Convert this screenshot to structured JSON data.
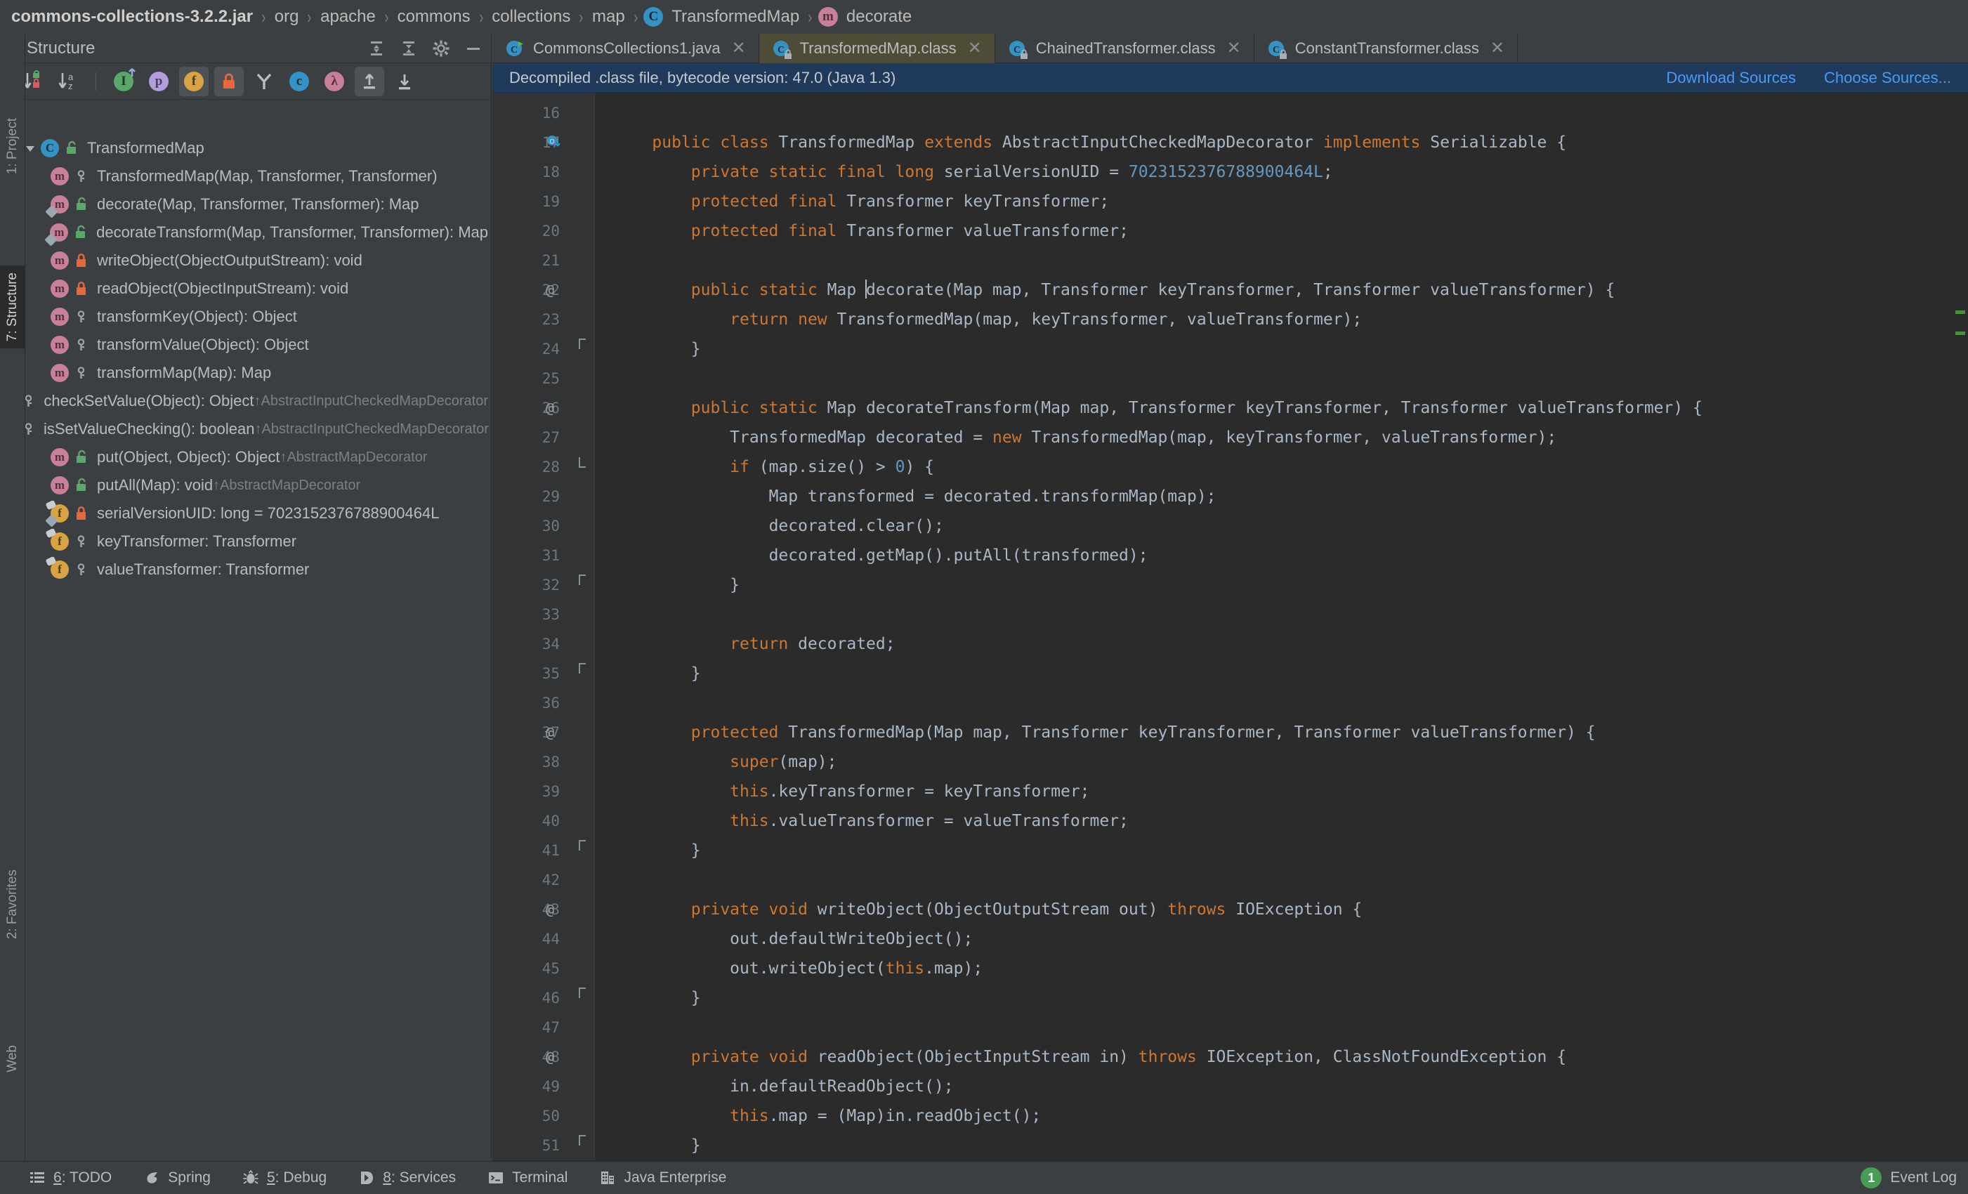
{
  "breadcrumb": {
    "items": [
      {
        "label": "commons-collections-3.2.2.jar",
        "icon": "",
        "bold": true
      },
      {
        "label": "org",
        "icon": "",
        "bold": false
      },
      {
        "label": "apache",
        "icon": "",
        "bold": false
      },
      {
        "label": "commons",
        "icon": "",
        "bold": false
      },
      {
        "label": "collections",
        "icon": "",
        "bold": false
      },
      {
        "label": "map",
        "icon": "",
        "bold": false
      },
      {
        "label": "TransformedMap",
        "icon": "class-icon",
        "bold": false
      },
      {
        "label": "decorate",
        "icon": "method-icon",
        "bold": false
      }
    ],
    "separator": "›"
  },
  "structure": {
    "title": "Structure",
    "header_buttons": [
      {
        "name": "expand-all-button",
        "icon": "expand-all-icon"
      },
      {
        "name": "collapse-all-button",
        "icon": "collapse-all-icon"
      },
      {
        "name": "settings-button",
        "icon": "gear-icon"
      },
      {
        "name": "hide-button",
        "icon": "minimize-icon"
      }
    ],
    "toolbar": [
      {
        "name": "sort-by-visibility-button",
        "icon": "sort-visibility-icon",
        "active": false
      },
      {
        "name": "sort-alphabetically-button",
        "icon": "sort-alpha-icon",
        "active": false
      },
      {
        "name": "show-inherited-button",
        "icon": "inherited-icon",
        "active": false,
        "glyph": "I"
      },
      {
        "name": "show-properties-button",
        "icon": "properties-icon",
        "active": false,
        "glyph": "p"
      },
      {
        "name": "show-fields-button",
        "icon": "fields-icon",
        "active": true,
        "glyph": "f"
      },
      {
        "name": "show-non-public-button",
        "icon": "lock-icon",
        "active": true,
        "glyph": ""
      },
      {
        "name": "group-methods-button",
        "icon": "group-methods-icon",
        "active": false
      },
      {
        "name": "show-anonymous-button",
        "icon": "anonymous-classes-icon",
        "active": false
      },
      {
        "name": "show-lambdas-button",
        "icon": "lambda-icon",
        "active": false
      },
      {
        "name": "autoscroll-to-source-button",
        "icon": "autoscroll-to-source-icon",
        "active": true
      },
      {
        "name": "autoscroll-from-source-button",
        "icon": "autoscroll-from-source-icon",
        "active": false
      }
    ],
    "tree": [
      {
        "label": "TransformedMap",
        "kind": "class",
        "modifier": "public",
        "indent": 0,
        "expanded": true,
        "override": false,
        "inherited": ""
      },
      {
        "label": "TransformedMap(Map, Transformer, Transformer)",
        "kind": "method",
        "modifier": "protected",
        "indent": 1,
        "override": false,
        "inherited": ""
      },
      {
        "label": "decorate(Map, Transformer, Transformer): Map",
        "kind": "method",
        "modifier": "public",
        "indent": 1,
        "override": true,
        "inherited": ""
      },
      {
        "label": "decorateTransform(Map, Transformer, Transformer): Map",
        "kind": "method",
        "modifier": "public",
        "indent": 1,
        "override": true,
        "inherited": ""
      },
      {
        "label": "writeObject(ObjectOutputStream): void",
        "kind": "method",
        "modifier": "private",
        "indent": 1,
        "override": false,
        "inherited": ""
      },
      {
        "label": "readObject(ObjectInputStream): void",
        "kind": "method",
        "modifier": "private",
        "indent": 1,
        "override": false,
        "inherited": ""
      },
      {
        "label": "transformKey(Object): Object",
        "kind": "method",
        "modifier": "protected",
        "indent": 1,
        "override": false,
        "inherited": ""
      },
      {
        "label": "transformValue(Object): Object",
        "kind": "method",
        "modifier": "protected",
        "indent": 1,
        "override": false,
        "inherited": ""
      },
      {
        "label": "transformMap(Map): Map",
        "kind": "method",
        "modifier": "protected",
        "indent": 1,
        "override": false,
        "inherited": ""
      },
      {
        "label": "checkSetValue(Object): Object",
        "kind": "method",
        "modifier": "protected",
        "indent": 1,
        "override": false,
        "inherited": "↑AbstractInputCheckedMapDecorator"
      },
      {
        "label": "isSetValueChecking(): boolean",
        "kind": "method",
        "modifier": "protected",
        "indent": 1,
        "override": false,
        "inherited": "↑AbstractInputCheckedMapDecorator"
      },
      {
        "label": "put(Object, Object): Object",
        "kind": "method",
        "modifier": "public",
        "indent": 1,
        "override": false,
        "inherited": "↑AbstractMapDecorator"
      },
      {
        "label": "putAll(Map): void",
        "kind": "method",
        "modifier": "public",
        "indent": 1,
        "override": false,
        "inherited": "↑AbstractMapDecorator"
      },
      {
        "label": "serialVersionUID: long = 7023152376788900464L",
        "kind": "field",
        "modifier": "private",
        "indent": 1,
        "override": true,
        "inherited": ""
      },
      {
        "label": "keyTransformer: Transformer",
        "kind": "field",
        "modifier": "protected",
        "indent": 1,
        "override": false,
        "inherited": ""
      },
      {
        "label": "valueTransformer: Transformer",
        "kind": "field",
        "modifier": "protected",
        "indent": 1,
        "override": false,
        "inherited": ""
      }
    ]
  },
  "left_rail": [
    {
      "label": "1: Project",
      "name": "rail-project",
      "selected": false
    },
    {
      "label": "7: Structure",
      "name": "rail-structure",
      "selected": true
    },
    {
      "label": "2: Favorites",
      "name": "rail-favorites",
      "selected": false
    },
    {
      "label": "Web",
      "name": "rail-web",
      "selected": false
    }
  ],
  "editor": {
    "tabs": [
      {
        "label": "CommonsCollections1.java",
        "icon": "java-class-icon",
        "active": false,
        "locked": false
      },
      {
        "label": "TransformedMap.class",
        "icon": "java-class-icon",
        "active": true,
        "locked": true
      },
      {
        "label": "ChainedTransformer.class",
        "icon": "java-class-icon",
        "active": false,
        "locked": true
      },
      {
        "label": "ConstantTransformer.class",
        "icon": "java-class-icon",
        "active": false,
        "locked": true
      }
    ],
    "notification": {
      "text": "Decompiled .class file, bytecode version: 47.0 (Java 1.3)",
      "links": [
        "Download Sources",
        "Choose Sources..."
      ],
      "background": "#1f3a5a",
      "link_color": "#4a9bf5"
    },
    "first_line_number": 16,
    "lines": [
      {
        "n": 16,
        "tokens": [],
        "gmark": "",
        "fold": ""
      },
      {
        "n": 17,
        "gmark": "impl",
        "fold": "",
        "tokens": [
          {
            "t": "    ",
            "c": ""
          },
          {
            "t": "public ",
            "c": "kw"
          },
          {
            "t": "class ",
            "c": "kw"
          },
          {
            "t": "TransformedMap ",
            "c": "cls"
          },
          {
            "t": "extends ",
            "c": "kw"
          },
          {
            "t": "AbstractInputCheckedMapDecorator ",
            "c": "cls"
          },
          {
            "t": "implements ",
            "c": "kw"
          },
          {
            "t": "Serializable {",
            "c": "cls"
          }
        ]
      },
      {
        "n": 18,
        "gmark": "",
        "fold": "",
        "tokens": [
          {
            "t": "        ",
            "c": ""
          },
          {
            "t": "private static final long ",
            "c": "kw"
          },
          {
            "t": "serialVersionUID = ",
            "c": "cls"
          },
          {
            "t": "7023152376788900464L",
            "c": "num"
          },
          {
            "t": ";",
            "c": "cls"
          }
        ]
      },
      {
        "n": 19,
        "gmark": "",
        "fold": "",
        "tokens": [
          {
            "t": "        ",
            "c": ""
          },
          {
            "t": "protected final ",
            "c": "kw"
          },
          {
            "t": "Transformer keyTransformer;",
            "c": "cls"
          }
        ]
      },
      {
        "n": 20,
        "gmark": "",
        "fold": "",
        "tokens": [
          {
            "t": "        ",
            "c": ""
          },
          {
            "t": "protected final ",
            "c": "kw"
          },
          {
            "t": "Transformer valueTransformer;",
            "c": "cls"
          }
        ]
      },
      {
        "n": 21,
        "gmark": "",
        "fold": "",
        "tokens": []
      },
      {
        "n": 22,
        "gmark": "@",
        "fold": "",
        "tokens": [
          {
            "t": "        ",
            "c": ""
          },
          {
            "t": "public static ",
            "c": "kw"
          },
          {
            "t": "Map ",
            "c": "cls"
          },
          {
            "t": "|CURSOR|",
            "c": "cursor"
          },
          {
            "t": "decorate(Map map, Transformer keyTransformer, Transformer valueTransformer) {",
            "c": "cls"
          }
        ]
      },
      {
        "n": 23,
        "gmark": "",
        "fold": "",
        "tokens": [
          {
            "t": "            ",
            "c": ""
          },
          {
            "t": "return new ",
            "c": "kw"
          },
          {
            "t": "TransformedMap(map, keyTransformer, valueTransformer);",
            "c": "cls"
          }
        ]
      },
      {
        "n": 24,
        "gmark": "",
        "fold": "up",
        "tokens": [
          {
            "t": "        }",
            "c": "cls"
          }
        ]
      },
      {
        "n": 25,
        "gmark": "",
        "fold": "",
        "tokens": []
      },
      {
        "n": 26,
        "gmark": "@",
        "fold": "",
        "tokens": [
          {
            "t": "        ",
            "c": ""
          },
          {
            "t": "public static ",
            "c": "kw"
          },
          {
            "t": "Map decorateTransform(Map map, Transformer keyTransformer, Transformer valueTransformer) {",
            "c": "cls"
          }
        ]
      },
      {
        "n": 27,
        "gmark": "",
        "fold": "",
        "tokens": [
          {
            "t": "            ",
            "c": ""
          },
          {
            "t": "TransformedMap decorated = ",
            "c": "cls"
          },
          {
            "t": "new ",
            "c": "kw"
          },
          {
            "t": "TransformedMap(map, keyTransformer, valueTransformer);",
            "c": "cls"
          }
        ]
      },
      {
        "n": 28,
        "gmark": "",
        "fold": "down",
        "tokens": [
          {
            "t": "            ",
            "c": ""
          },
          {
            "t": "if ",
            "c": "kw"
          },
          {
            "t": "(map.size() > ",
            "c": "cls"
          },
          {
            "t": "0",
            "c": "num"
          },
          {
            "t": ") {",
            "c": "cls"
          }
        ]
      },
      {
        "n": 29,
        "gmark": "",
        "fold": "",
        "tokens": [
          {
            "t": "                ",
            "c": ""
          },
          {
            "t": "Map transformed = decorated.transformMap(map);",
            "c": "cls"
          }
        ]
      },
      {
        "n": 30,
        "gmark": "",
        "fold": "",
        "tokens": [
          {
            "t": "                ",
            "c": ""
          },
          {
            "t": "decorated.clear();",
            "c": "cls"
          }
        ]
      },
      {
        "n": 31,
        "gmark": "",
        "fold": "",
        "tokens": [
          {
            "t": "                ",
            "c": ""
          },
          {
            "t": "decorated.getMap().putAll(transformed);",
            "c": "cls"
          }
        ]
      },
      {
        "n": 32,
        "gmark": "",
        "fold": "up",
        "tokens": [
          {
            "t": "            }",
            "c": "cls"
          }
        ]
      },
      {
        "n": 33,
        "gmark": "",
        "fold": "",
        "tokens": []
      },
      {
        "n": 34,
        "gmark": "",
        "fold": "",
        "tokens": [
          {
            "t": "            ",
            "c": ""
          },
          {
            "t": "return ",
            "c": "kw"
          },
          {
            "t": "decorated;",
            "c": "cls"
          }
        ]
      },
      {
        "n": 35,
        "gmark": "",
        "fold": "up",
        "tokens": [
          {
            "t": "        }",
            "c": "cls"
          }
        ]
      },
      {
        "n": 36,
        "gmark": "",
        "fold": "",
        "tokens": []
      },
      {
        "n": 37,
        "gmark": "@",
        "fold": "",
        "tokens": [
          {
            "t": "        ",
            "c": ""
          },
          {
            "t": "protected ",
            "c": "kw"
          },
          {
            "t": "TransformedMap(Map map, Transformer keyTransformer, Transformer valueTransformer) {",
            "c": "cls"
          }
        ]
      },
      {
        "n": 38,
        "gmark": "",
        "fold": "",
        "tokens": [
          {
            "t": "            ",
            "c": ""
          },
          {
            "t": "super",
            "c": "kw"
          },
          {
            "t": "(map);",
            "c": "cls"
          }
        ]
      },
      {
        "n": 39,
        "gmark": "",
        "fold": "",
        "tokens": [
          {
            "t": "            ",
            "c": ""
          },
          {
            "t": "this",
            "c": "kw"
          },
          {
            "t": ".keyTransformer = keyTransformer;",
            "c": "cls"
          }
        ]
      },
      {
        "n": 40,
        "gmark": "",
        "fold": "",
        "tokens": [
          {
            "t": "            ",
            "c": ""
          },
          {
            "t": "this",
            "c": "kw"
          },
          {
            "t": ".valueTransformer = valueTransformer;",
            "c": "cls"
          }
        ]
      },
      {
        "n": 41,
        "gmark": "",
        "fold": "up",
        "tokens": [
          {
            "t": "        }",
            "c": "cls"
          }
        ]
      },
      {
        "n": 42,
        "gmark": "",
        "fold": "",
        "tokens": []
      },
      {
        "n": 43,
        "gmark": "@",
        "fold": "",
        "tokens": [
          {
            "t": "        ",
            "c": ""
          },
          {
            "t": "private void ",
            "c": "kw"
          },
          {
            "t": "writeObject(ObjectOutputStream out) ",
            "c": "cls"
          },
          {
            "t": "throws ",
            "c": "kw"
          },
          {
            "t": "IOException {",
            "c": "cls"
          }
        ]
      },
      {
        "n": 44,
        "gmark": "",
        "fold": "",
        "tokens": [
          {
            "t": "            ",
            "c": ""
          },
          {
            "t": "out.defaultWriteObject();",
            "c": "cls"
          }
        ]
      },
      {
        "n": 45,
        "gmark": "",
        "fold": "",
        "tokens": [
          {
            "t": "            ",
            "c": ""
          },
          {
            "t": "out.writeObject(",
            "c": "cls"
          },
          {
            "t": "this",
            "c": "kw"
          },
          {
            "t": ".map);",
            "c": "cls"
          }
        ]
      },
      {
        "n": 46,
        "gmark": "",
        "fold": "up",
        "tokens": [
          {
            "t": "        }",
            "c": "cls"
          }
        ]
      },
      {
        "n": 47,
        "gmark": "",
        "fold": "",
        "tokens": []
      },
      {
        "n": 48,
        "gmark": "@",
        "fold": "",
        "tokens": [
          {
            "t": "        ",
            "c": ""
          },
          {
            "t": "private void ",
            "c": "kw"
          },
          {
            "t": "readObject(ObjectInputStream in) ",
            "c": "cls"
          },
          {
            "t": "throws ",
            "c": "kw"
          },
          {
            "t": "IOException, ClassNotFoundException {",
            "c": "cls"
          }
        ]
      },
      {
        "n": 49,
        "gmark": "",
        "fold": "",
        "tokens": [
          {
            "t": "            ",
            "c": ""
          },
          {
            "t": "in.defaultReadObject();",
            "c": "cls"
          }
        ]
      },
      {
        "n": 50,
        "gmark": "",
        "fold": "",
        "tokens": [
          {
            "t": "            ",
            "c": ""
          },
          {
            "t": "this",
            "c": "kw"
          },
          {
            "t": ".map = (Map)in.readObject();",
            "c": "cls"
          }
        ]
      },
      {
        "n": 51,
        "gmark": "",
        "fold": "up",
        "tokens": [
          {
            "t": "        }",
            "c": "cls"
          }
        ]
      }
    ]
  },
  "status_bar": {
    "items": [
      {
        "label": "6: TODO",
        "accel": "6",
        "icon": "todo-icon"
      },
      {
        "label": "Spring",
        "accel": "",
        "icon": "spring-icon"
      },
      {
        "label": "5: Debug",
        "accel": "5",
        "icon": "debug-icon"
      },
      {
        "label": "8: Services",
        "accel": "8",
        "icon": "services-icon"
      },
      {
        "label": "Terminal",
        "accel": "",
        "icon": "terminal-icon"
      },
      {
        "label": "Java Enterprise",
        "accel": "",
        "icon": "java-enterprise-icon"
      }
    ],
    "event_log": {
      "label": "Event Log",
      "count": "1",
      "badge_color": "#499c54"
    }
  },
  "colors": {
    "background": "#3c3f41",
    "editor_background": "#2b2b2b",
    "gutter": "#313335",
    "keyword": "#cc7832",
    "number": "#6897bb",
    "identifier": "#a9b7c6",
    "active_tab": "#4e4b37",
    "notification": "#1f3a5a",
    "link": "#4a9bf5"
  }
}
